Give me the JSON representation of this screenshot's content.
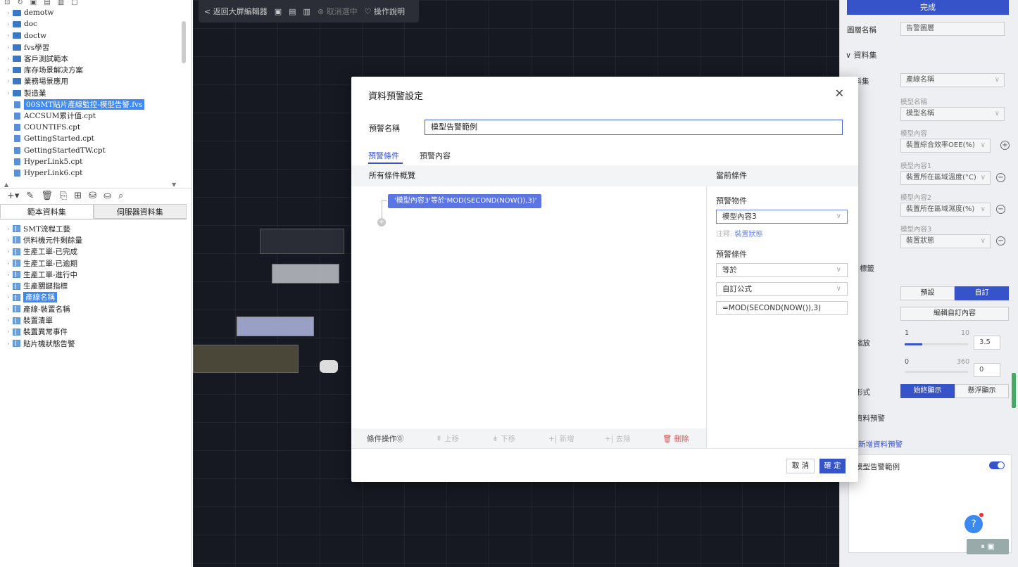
{
  "left": {
    "tree_items": [
      {
        "type": "folder",
        "label": "demotw"
      },
      {
        "type": "folder",
        "label": "doc"
      },
      {
        "type": "folder",
        "label": "doctw"
      },
      {
        "type": "folder",
        "label": "fvs學習"
      },
      {
        "type": "folder",
        "label": "客戶測試範本"
      },
      {
        "type": "folder",
        "label": "库存场景解决方案"
      },
      {
        "type": "folder",
        "label": "業務場景應用"
      },
      {
        "type": "folder",
        "label": "製造業"
      },
      {
        "type": "file",
        "label": "00SMT貼片產線監控-模型告警.fvs",
        "selected": true
      },
      {
        "type": "file",
        "label": "ACCSUM累计值.cpt"
      },
      {
        "type": "file",
        "label": "COUNTIFS.cpt"
      },
      {
        "type": "file",
        "label": "GettingStarted.cpt"
      },
      {
        "type": "file",
        "label": "GettingStartedTW.cpt"
      },
      {
        "type": "file",
        "label": "HyperLink5.cpt"
      },
      {
        "type": "file",
        "label": "HyperLink6.cpt"
      }
    ],
    "tabs": [
      "範本資料集",
      "伺服器資料集"
    ],
    "datasets": [
      {
        "label": "SMT流程工藝"
      },
      {
        "label": "供料機元件剩餘量"
      },
      {
        "label": "生產工單-已完成"
      },
      {
        "label": "生產工單-已逾期"
      },
      {
        "label": "生產工單-進行中"
      },
      {
        "label": "生產關鍵指標"
      },
      {
        "label": "產線名稱",
        "selected": true
      },
      {
        "label": "產線-裝置名稱"
      },
      {
        "label": "裝置清單"
      },
      {
        "label": "裝置異常事件"
      },
      {
        "label": "貼片機狀態告警"
      }
    ]
  },
  "topbar": {
    "back": "< 返回大屏編輯器",
    "cancel_select": "⊗ 取消選中",
    "help": "♡ 操作說明"
  },
  "right": {
    "done": "完成",
    "layer_name_label": "圖層名稱",
    "layer_name_value": "告警圖層",
    "dataset_section": "∨ 資料集",
    "dataset_label": "資料集",
    "dataset_value": "產線名稱",
    "model_name_small": "模型名稱",
    "model_name_value": "模型名稱",
    "model_content_small": "模型內容",
    "model_content_value": "裝置綜合效率OEE(%)",
    "model_content1_small": "模型內容1",
    "model_content1_value": "裝置所在區域溫度(°C)",
    "model_content2_small": "模型內容2",
    "model_content2_value": "裝置所在區域濕度(%)",
    "model_content3_small": "模型內容3",
    "model_content3_value": "裝置狀態",
    "style_label": "標籤",
    "preset": "預設",
    "custom": "自訂",
    "edit_custom": "編輯自訂內容",
    "scale_label": "縮放",
    "scale_min": "1",
    "scale_max": "10",
    "scale_value": "3.5",
    "scale_fraction": 0.28,
    "angle_min": "0",
    "angle_max": "360",
    "angle_value": "0",
    "angle_fraction": 0,
    "display_label": "形式",
    "always_show": "始終顯示",
    "hover_show": "懸浮顯示",
    "warn_section": "資料預警",
    "add_warn": "新增資料預警",
    "warn_item": "模型告警範例",
    "help_badge": "?"
  },
  "modal": {
    "title": "資料預警設定",
    "name_label": "預警名稱",
    "name_value": "模型告警範例",
    "tab_condition": "預警條件",
    "tab_content": "預警內容",
    "all_conditions": "所有條件概覽",
    "current_condition": "當前條件",
    "condition_chip": "'模型內容3'等於'MOD(SECOND(NOW()),3)'",
    "ops_label": "條件操作⓪",
    "op_up": "⇞ 上移",
    "op_down": "⇟ 下移",
    "op_add": "+| 新增",
    "op_remove": "+| 去除",
    "op_delete": "🗑 刪除",
    "warn_object_label": "預警物件",
    "warn_object_value": "模型內容3",
    "hint_prefix": "注釋: ",
    "hint_value": "裝置狀態",
    "warn_cond_label": "預警條件",
    "operator_value": "等於",
    "formula_type_value": "自訂公式",
    "formula_value": "=MOD(SECOND(NOW()),3)",
    "cancel": "取 消",
    "ok": "確 定"
  }
}
